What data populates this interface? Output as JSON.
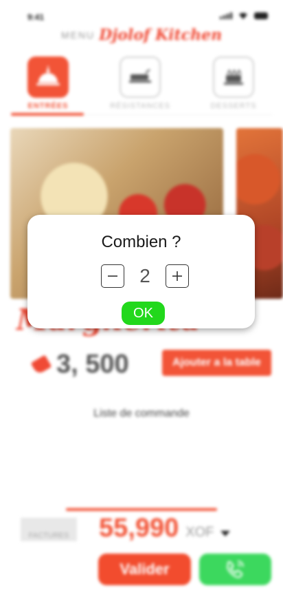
{
  "status_bar": {
    "time": "9:41"
  },
  "header": {
    "menu_label": "MENU",
    "brand": "Djolof Kitchen"
  },
  "tabs": [
    {
      "label": "ENTRÉES",
      "icon": "dish-icon",
      "active": true
    },
    {
      "label": "RÉSISTANCES",
      "icon": "tray-icon",
      "active": false
    },
    {
      "label": "DESSERTS",
      "icon": "cake-icon",
      "active": false
    }
  ],
  "dish": {
    "name": "Margherita",
    "price": "3, 500",
    "add_label": "Ajouter a la table"
  },
  "order_list": {
    "label": "Liste de commande"
  },
  "footer": {
    "factures_label": "FACTURES",
    "total": "55,990",
    "currency": "XOF",
    "validate_label": "Valider",
    "call_icon": "phone-icon"
  },
  "colors": {
    "accent": "#f25437",
    "ok_green": "#22d81c",
    "call_green": "#3cd85e"
  },
  "modal": {
    "title": "Combien ?",
    "quantity": "2",
    "minus_symbol": "−",
    "plus_symbol": "+",
    "ok_label": "OK"
  }
}
